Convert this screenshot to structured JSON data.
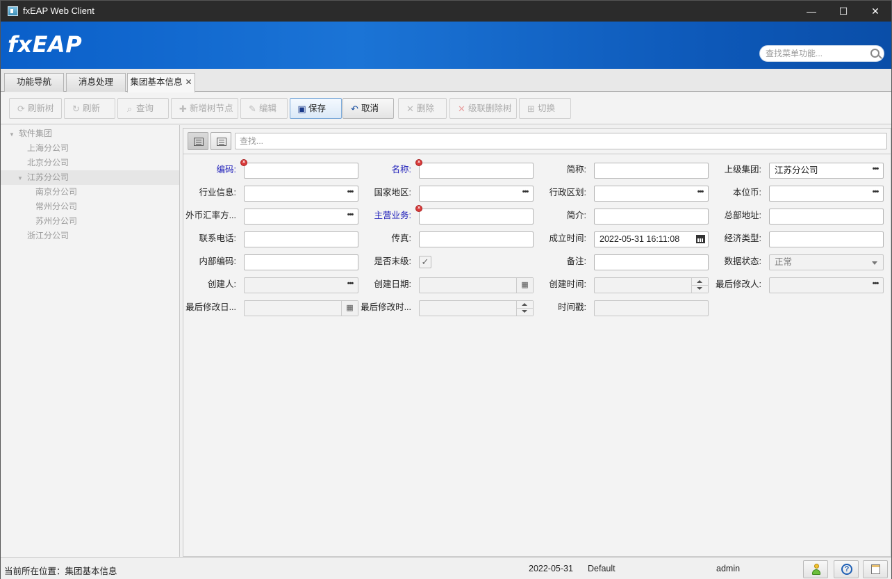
{
  "window": {
    "title": "fxEAP Web Client",
    "minimize": "—",
    "maximize": "☐",
    "close": "✕"
  },
  "banner": {
    "logo": "fxEAP",
    "search_placeholder": "查找菜单功能..."
  },
  "tabs": [
    {
      "label": "功能导航"
    },
    {
      "label": "消息处理"
    },
    {
      "label": "集团基本信息",
      "close": "✕"
    }
  ],
  "toolbar": {
    "refresh_tree": "刷新树",
    "refresh": "刷新",
    "query": "查询",
    "add_node": "新增树节点",
    "edit": "编辑",
    "save": "保存",
    "cancel": "取消",
    "delete": "删除",
    "cascade_delete": "级联删除树",
    "switch": "切换"
  },
  "tree": [
    {
      "label": "软件集团",
      "level": 0,
      "expanded": true
    },
    {
      "label": "上海分公司",
      "level": 1
    },
    {
      "label": "北京分公司",
      "level": 1
    },
    {
      "label": "江苏分公司",
      "level": 1,
      "expanded": true,
      "selected": true
    },
    {
      "label": "南京分公司",
      "level": 2
    },
    {
      "label": "常州分公司",
      "level": 2
    },
    {
      "label": "苏州分公司",
      "level": 2
    },
    {
      "label": "浙江分公司",
      "level": 1
    }
  ],
  "panel": {
    "search_placeholder": "查找..."
  },
  "form": {
    "code": {
      "label": "编码:",
      "value": ""
    },
    "name": {
      "label": "名称:",
      "value": ""
    },
    "short_name": {
      "label": "简称:",
      "value": ""
    },
    "parent_group": {
      "label": "上级集团:",
      "value": "江苏分公司"
    },
    "industry": {
      "label": "行业信息:",
      "value": ""
    },
    "country": {
      "label": "国家地区:",
      "value": ""
    },
    "region": {
      "label": "行政区划:",
      "value": ""
    },
    "currency": {
      "label": "本位币:",
      "value": ""
    },
    "fx_rate": {
      "label": "外币汇率方...",
      "value": ""
    },
    "main_business": {
      "label": "主营业务:",
      "value": ""
    },
    "intro": {
      "label": "简介:",
      "value": ""
    },
    "hq_address": {
      "label": "总部地址:",
      "value": ""
    },
    "phone": {
      "label": "联系电话:",
      "value": ""
    },
    "fax": {
      "label": "传真:",
      "value": ""
    },
    "founded": {
      "label": "成立时间:",
      "value": "2022-05-31 16:11:08"
    },
    "economy_type": {
      "label": "经济类型:",
      "value": ""
    },
    "internal_code": {
      "label": "内部编码:",
      "value": ""
    },
    "is_leaf": {
      "label": "是否末级:",
      "checked": true,
      "mark": "✓"
    },
    "remark": {
      "label": "备注:",
      "value": ""
    },
    "data_status": {
      "label": "数据状态:",
      "value": "正常"
    },
    "creator": {
      "label": "创建人:",
      "value": ""
    },
    "create_date": {
      "label": "创建日期:",
      "value": ""
    },
    "create_time": {
      "label": "创建时间:",
      "value": ""
    },
    "last_modifier": {
      "label": "最后修改人:",
      "value": ""
    },
    "last_mod_date": {
      "label": "最后修改日...",
      "value": ""
    },
    "last_mod_time": {
      "label": "最后修改时...",
      "value": ""
    },
    "timestamp": {
      "label": "时间戳:",
      "value": ""
    }
  },
  "status": {
    "location": "当前所在位置：集团基本信息",
    "date": "2022-05-31",
    "theme": "Default",
    "user": "admin"
  }
}
